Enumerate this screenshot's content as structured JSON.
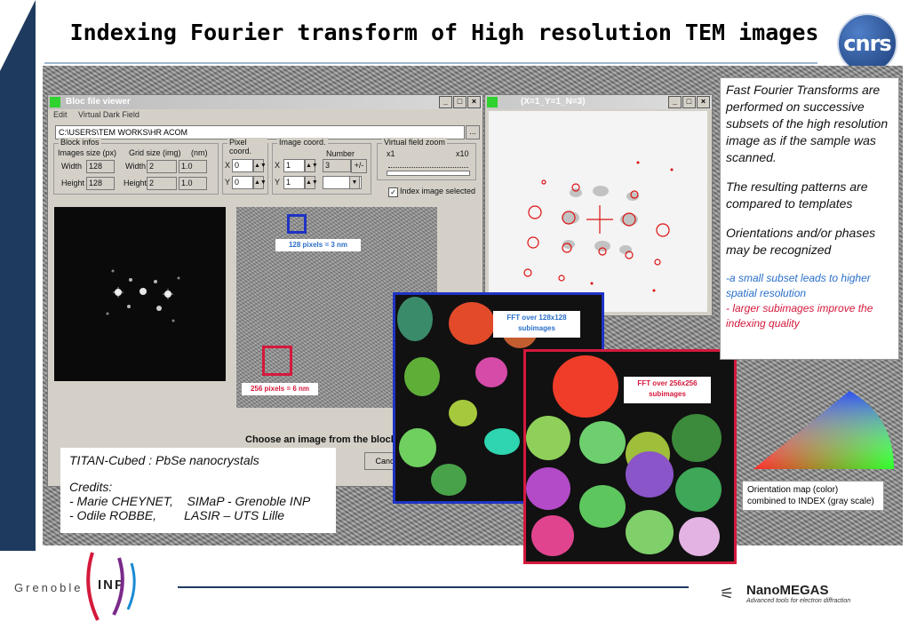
{
  "slide": {
    "title": "Indexing Fourier transform of High resolution TEM images",
    "cnrs_logo_text": "cnrs"
  },
  "bloc_viewer": {
    "window_title": "Bloc file viewer",
    "menu": [
      "Edit",
      "Virtual Dark Field"
    ],
    "path": "C:\\USERS\\TEM WORKS\\HR ACOM",
    "browse_label": "...",
    "block_infos": {
      "label": "Block infos",
      "images_size_label": "Images size (px)",
      "grid_size_label": "Grid size (img)",
      "nm_label": "(nm)",
      "width_label": "Width",
      "height_label": "Height",
      "img_width": "128",
      "img_height": "128",
      "grid_width": "2",
      "grid_height": "2",
      "nm_width": "1.0",
      "nm_height": "1.0"
    },
    "pixel_coord": {
      "label": "Pixel coord.",
      "x_label": "X",
      "y_label": "Y",
      "x": "0",
      "y": "0"
    },
    "image_coord": {
      "label": "Image coord.",
      "number_label": "Number",
      "x_label": "X",
      "y_label": "Y",
      "x": "1",
      "y": "1",
      "number": "3",
      "plusminus": "+/-"
    },
    "virtual_zoom": {
      "label": "Virtual field zoom",
      "min": "x1",
      "max": "x10",
      "level": 1.0
    },
    "index_checkbox": {
      "label": "Index image selected",
      "checked": true
    },
    "label_128": "128 pixels = 3 nm",
    "label_256": "256 pixels = 6 nm",
    "choose_text": "Choose an image from the block",
    "cancel_label": "Canc"
  },
  "pattern_window": {
    "title": "(X=1_Y=1_N=3)"
  },
  "overlays": {
    "fft128": "FFT over 128x128 subimages",
    "fft256": "FFT over 256x256 subimages"
  },
  "sample_box": {
    "line1": "TITAN-Cubed :  PbSe nanocrystals",
    "credits": "Credits:",
    "credit1_name": "- Marie CHEYNET,",
    "credit1_lab": "SIMaP - Grenoble INP",
    "credit2_name": "- Odile ROBBE,",
    "credit2_lab": "LASIR – UTS Lille"
  },
  "right_text": {
    "p1": "Fast Fourier Transforms are performed on successive subsets of the high resolution image as if the sample was scanned.",
    "p2": "The resulting patterns are compared to templates",
    "p3": "Orientations and/or phases may be recognized",
    "blue": "-a small subset leads to higher spatial resolution",
    "red": "- larger subimages improve the indexing quality"
  },
  "orientation_caption": "Orientation map (color) combined to INDEX (gray scale)",
  "footer": {
    "grenoble": "Grenoble",
    "inp": "INP",
    "nanomegas": "NanoMEGAS",
    "nanomegas_tagline": "Advanced tools for electron diffraction"
  },
  "colors": {
    "accent_navy": "#1f3a5f",
    "red_label": "#d4193b",
    "blue_label": "#2a6fc9"
  }
}
